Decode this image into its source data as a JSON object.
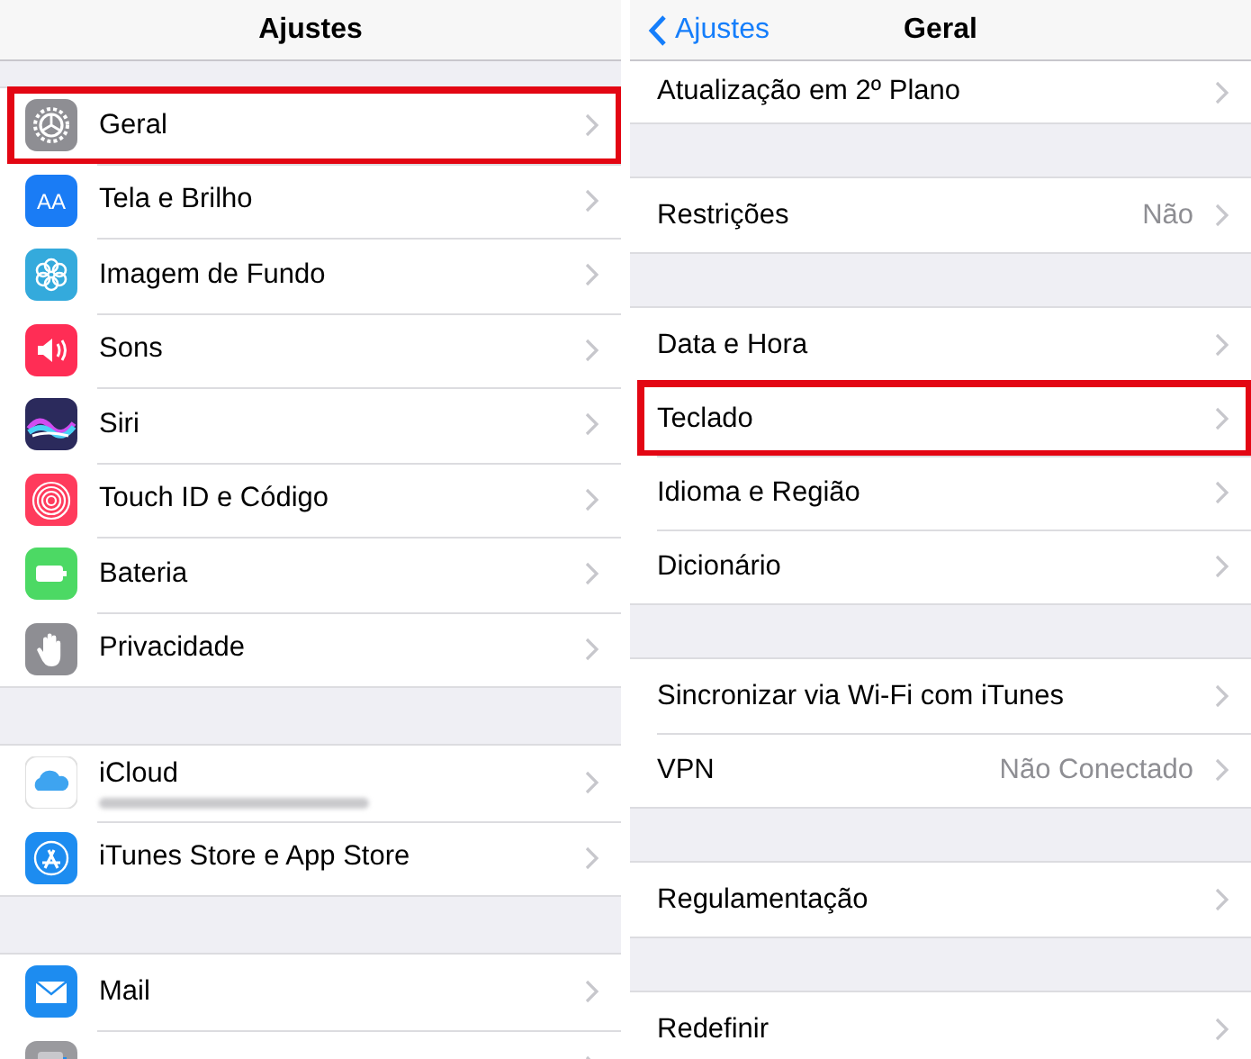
{
  "left": {
    "title": "Ajustes",
    "groups": [
      {
        "rows": [
          {
            "label": "Geral",
            "highlighted": true
          },
          {
            "label": "Tela e Brilho",
            "icon_label": "AA",
            "highlighted": false
          },
          {
            "label": "Imagem de Fundo",
            "highlighted": false
          },
          {
            "label": "Sons",
            "highlighted": false
          },
          {
            "label": "Siri",
            "highlighted": false
          },
          {
            "label": "Touch ID e Código",
            "highlighted": false
          },
          {
            "label": "Bateria",
            "highlighted": false
          },
          {
            "label": "Privacidade",
            "highlighted": false
          }
        ]
      },
      {
        "rows": [
          {
            "label": "iCloud",
            "redacted_subtitle": true,
            "highlighted": false
          },
          {
            "label": "iTunes Store e App Store",
            "highlighted": false
          }
        ]
      },
      {
        "rows": [
          {
            "label": "Mail",
            "highlighted": false
          },
          {
            "highlighted": false
          }
        ]
      }
    ]
  },
  "right": {
    "back": "Ajustes",
    "title": "Geral",
    "groups": [
      {
        "rows": [
          {
            "label": "Atualização em 2º Plano",
            "highlighted": false
          }
        ]
      },
      {
        "rows": [
          {
            "label": "Restrições",
            "value": "Não",
            "highlighted": false
          }
        ]
      },
      {
        "rows": [
          {
            "label": "Data e Hora",
            "highlighted": false
          },
          {
            "label": "Teclado",
            "highlighted": true
          },
          {
            "label": "Idioma e Região",
            "highlighted": false
          },
          {
            "label": "Dicionário",
            "highlighted": false
          }
        ]
      },
      {
        "rows": [
          {
            "label": "Sincronizar via Wi-Fi com iTunes",
            "highlighted": false
          },
          {
            "label": "VPN",
            "value": "Não Conectado",
            "highlighted": false
          }
        ]
      },
      {
        "rows": [
          {
            "label": "Regulamentação",
            "highlighted": false
          }
        ]
      },
      {
        "rows": [
          {
            "label": "Redefinir",
            "highlighted": false
          }
        ]
      }
    ]
  }
}
